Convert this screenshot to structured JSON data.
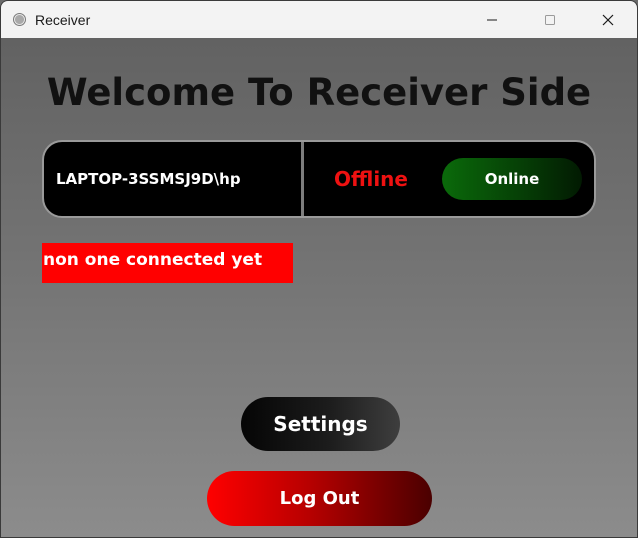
{
  "window": {
    "title": "Receiver",
    "icon": "app-circle-icon",
    "controls": {
      "minimize_icon": "minimize-icon",
      "maximize_icon": "maximize-icon",
      "close_icon": "close-icon"
    }
  },
  "main": {
    "heading": "Welcome To Receiver Side",
    "status_panel": {
      "device_name": "LAPTOP-3SSMSJ9D\\hp",
      "status": "Offline",
      "status_color": "#ee1111",
      "online_button_label": "Online",
      "online_button_color": "#0a6a0a"
    },
    "connection_status": "non one connected yet",
    "connection_status_color": "#ff0000",
    "settings_button_label": "Settings",
    "logout_button_label": "Log Out",
    "logout_button_color": "#ff0000"
  }
}
